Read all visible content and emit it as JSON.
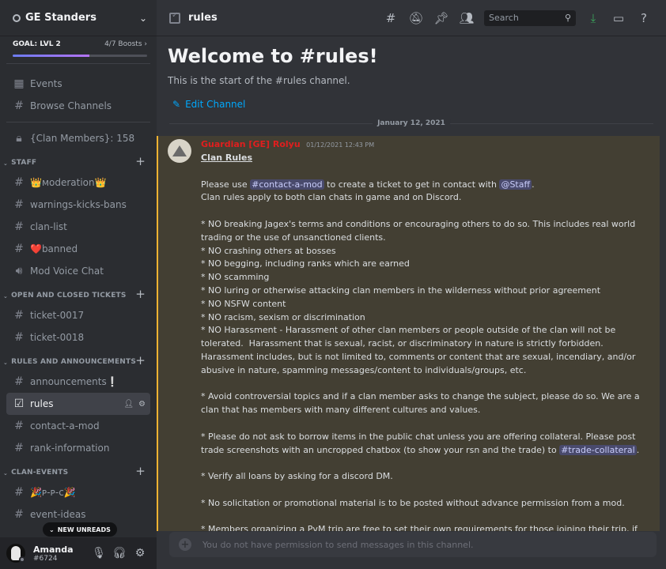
{
  "server": {
    "name": "GE Standers",
    "goal_label": "GOAL: LVL 2",
    "boosts": "4/7 Boosts",
    "goal_progress": 0.57
  },
  "sidebar": {
    "top_items": [
      {
        "label": "Events",
        "icon": "calendar-icon"
      },
      {
        "label": "Browse Channels",
        "icon": "browse-channels-icon"
      }
    ],
    "locked_channel": {
      "label": "{Clan Members}: 158",
      "icon": "lock-icon"
    },
    "categories": [
      {
        "name": "STAFF",
        "channels": [
          {
            "label": "👑ᴍoderation👑",
            "icon": "hashtag-icon"
          },
          {
            "label": "warnings-kicks-bans",
            "icon": "hashtag-icon"
          },
          {
            "label": "clan-list",
            "icon": "hashtag-icon"
          },
          {
            "label": "❤️banned",
            "icon": "hashtag-icon"
          },
          {
            "label": "Mod Voice Chat",
            "icon": "speaker-icon"
          }
        ]
      },
      {
        "name": "OPEN AND CLOSED TICKETS",
        "channels": [
          {
            "label": "ticket-0017",
            "icon": "hashtag-icon"
          },
          {
            "label": "ticket-0018",
            "icon": "hashtag-icon"
          }
        ]
      },
      {
        "name": "RULES AND ANNOUNCEMENTS",
        "channels": [
          {
            "label": "announcements❕",
            "icon": "hashtag-icon"
          },
          {
            "label": "rules",
            "icon": "rules-icon",
            "active": true
          },
          {
            "label": "contact-a-mod",
            "icon": "hashtag-icon"
          },
          {
            "label": "rank-information",
            "icon": "hashtag-icon"
          }
        ]
      },
      {
        "name": "CLAN-EVENTS",
        "channels": [
          {
            "label": "🎉ᴘ-ᴘ-ᴄ🎉",
            "icon": "hashtag-icon"
          },
          {
            "label": "event-ideas",
            "icon": "hashtag-icon"
          }
        ]
      }
    ],
    "new_unreads": "NEW UNREADS"
  },
  "user": {
    "name": "Amanda",
    "tag": "#6724"
  },
  "topbar": {
    "channel": "rules",
    "search_placeholder": "Search"
  },
  "welcome": {
    "title": "Welcome to #rules!",
    "subtitle": "This is the start of the #rules channel.",
    "edit_label": "Edit Channel"
  },
  "date_separator": "January 12, 2021",
  "message": {
    "author": "Guardian [GE] Rolyu",
    "timestamp": "01/12/2021 12:43 PM",
    "heading": "Clan Rules",
    "intro_pre": "Please use ",
    "mention_channel": "#contact-a-mod",
    "intro_mid": " to create a ticket to get in contact with ",
    "mention_role": "@Staff",
    "intro_post": ".",
    "line2": "Clan rules apply to both clan chats in game and on Discord.",
    "rules": [
      "* NO breaking Jagex's terms and conditions or encouraging others to do so. This includes real world trading or the use of unsanctioned clients.",
      "* NO crashing others at bosses",
      "* NO begging, including ranks which are earned",
      "* NO scamming",
      "* NO luring or otherwise attacking clan members in the wilderness without prior agreement",
      "* NO NSFW content",
      "* NO racism, sexism or discrimination",
      "* NO Harassment - Harassment of other clan members or people outside of the clan will not be tolerated.  Harassment that is sexual, racist, or discriminatory in nature is strictly forbidden. Harassment includes, but is not limited to, comments or content that are sexual, incendiary, and/or abusive in nature, spamming messages/content to individuals/groups, etc."
    ],
    "para_controversial": "* Avoid controversial topics and if a clan member asks to change the subject, please do so. We are a clan that has members with many different cultures and values.",
    "para_borrow_pre": "* Please do not ask to borrow items in the public chat unless you are offering collateral. Please post trade screenshots with an uncropped chatbox (to show your rsn and the trade) to ",
    "mention_trade": "#trade-collateral",
    "para_borrow_post": ".",
    "para_loans": "* Verify all loans by asking for a discord DM.",
    "para_solicit": "* No solicitation or promotional material is to be posted without advance permission from a mod.",
    "para_pvm": "* Members organizing a PvM trip are free to set their own requirements for those joining their trip, if"
  },
  "composer": {
    "placeholder": "You do not have permission to send messages in this channel."
  },
  "colors": {
    "accent": "#5865f2",
    "link": "#00a8fc",
    "highlight_bg": "#433f33",
    "highlight_border": "#f0b232",
    "author": "#e01e1e"
  }
}
